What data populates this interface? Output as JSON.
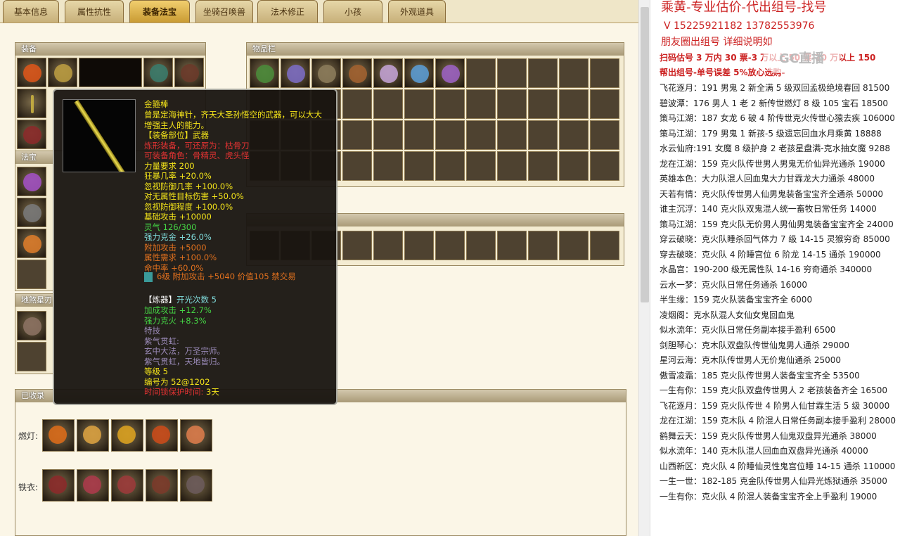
{
  "tabs": [
    "基本信息",
    "属性抗性",
    "装备法宝",
    "坐骑召唤兽",
    "法术修正",
    "小孩",
    "外观道具"
  ],
  "panels": {
    "equip": "装备",
    "fabao": "法宝",
    "didi": "地煞星刃",
    "items": "物品栏",
    "collected": "已收录"
  },
  "tooltip": {
    "name": "金箍棒",
    "lines": [
      {
        "t": "曾是定海神针，齐天大圣孙悟空的武器，可以大大",
        "c": "y"
      },
      {
        "t": "增强主人的能力。",
        "c": "y"
      },
      {
        "t": "【装备部位】武器",
        "c": "y"
      },
      {
        "t": "炼形装备，可还原为：枯骨刀",
        "c": "r"
      },
      {
        "t": "可装备角色：骨精灵、虎头怪",
        "c": "r"
      },
      {
        "t": "力量要求 200",
        "c": "y"
      },
      {
        "t": "狂暴几率 +20.0%",
        "c": "y"
      },
      {
        "t": "忽视防御几率 +100.0%",
        "c": "y"
      },
      {
        "t": "对无属性目标伤害 +50.0%",
        "c": "y"
      },
      {
        "t": "忽视防御程度 +100.0%",
        "c": "y"
      },
      {
        "t": "基础攻击 +10000",
        "c": "y"
      },
      {
        "t": "灵气 126/300",
        "c": "g"
      },
      {
        "t": "强力克金 +26.0%",
        "c": "c"
      },
      {
        "t": "附加攻击 +5000",
        "c": "o"
      },
      {
        "t": "属性需求 +100.0%",
        "c": "o"
      },
      {
        "t": "命中率 +60.0%",
        "c": "o"
      }
    ],
    "gem": "6级 附加攻击 +5040 价值105 禁交易",
    "lian_head": "【炼器】",
    "lian_count": "开光次数 5",
    "lian": [
      {
        "t": "加成攻击 +12.7%",
        "c": "g"
      },
      {
        "t": "强力克火 +8.3%",
        "c": "g"
      },
      {
        "t": "特技",
        "c": "p"
      },
      {
        "t": "紫气贯虹:",
        "c": "p"
      },
      {
        "t": "玄中大法，万圣宗师。",
        "c": "p"
      },
      {
        "t": "紫气贯虹，天地皆归。",
        "c": "p"
      },
      {
        "t": "等级 5",
        "c": "y"
      },
      {
        "t": "编号为 52@1202",
        "c": "y"
      }
    ],
    "time_label": "时间锁保护时间:",
    "time_val": "3天"
  },
  "collected": {
    "row1": "燃灯:",
    "row2": "铁衣:"
  },
  "chat": {
    "title": "乘黄-专业估价-代出组号-找号",
    "phone": "V 15225921182   13782553976",
    "line2": "朋友圈出组号   详细说明如",
    "line3": "扫码估号 3 万内 30 票-3 万以上 50 票-20 万以上 150",
    "line4": "帮出组号-单号误差 5%放心选购-",
    "watermark": "GC直播",
    "entries": [
      "飞花逐月：191 男鬼 2 新全满 5 级双回孟极绝境春回 81500",
      "碧波潭：176 男人 1 老 2 新传世燃灯 8 级 105 宝石 18500",
      "策马江湖：187 女龙 6 破 4 阶传世克火传世心猿去疾 106000",
      "策马江湖：179 男鬼 1 新孩-5 级遗忘回血水月乘黄 18888",
      "水云仙府:191 女魔 8 级护身 2 老孩星盘满-克水抽女魔 9288",
      "龙在江湖：159 克火队传世男人男鬼无价仙异光通杀 19000",
      "英雄本色：大力队混人回血鬼大力甘霖龙大力通杀 48000",
      "天若有情：克火队传世男人仙男鬼装备宝宝齐全通杀 50000",
      "谁主沉浮：140 克火队双鬼混人统一畜牧日常任务 14000",
      "策马江湖：159 克火队无价男人男仙男鬼装备宝宝齐全 24000",
      "穿云破晓：克火队睡杀回气体力 7 级 14-15 灵猴穷奇 85000",
      "穿去破晓：克火队 4 阶睡宫位 6 阶龙 14-15 通杀 190000",
      "水晶宫：190-200 级无属性队 14-16 穷奇通杀 340000",
      "云水一梦：克火队日常任务通杀 16000",
      "半生缘：159 克火队装备宝宝齐全 6000",
      "凌烟阁：克水队混人女仙女鬼回血鬼",
      "似水流年：克火队日常任务副本接手盈利 6500",
      "剑胆琴心：克木队双盘队传世仙鬼男人通杀 29000",
      "星河云海：克木队传世男人无价鬼仙通杀 25000",
      "傲雪凌霜：185 克火队传世男人装备宝宝齐全 53500",
      "一生有你：159 克火队双盘传世男人 2 老孩装备齐全 16500",
      "飞花逐月：159 克火队传世 4 阶男人仙甘霖生活 5 级 30000",
      "龙在江湖：159 克木队 4 阶混人日常任务副本接手盈利 28000",
      "鹤舞云天：159 克火队传世男人仙鬼双盘异光通杀 38000",
      "似水流年：140 克木队混人回血血双盘异光通杀 40000",
      "山西新区：克火队 4 阶睡仙灵性鬼宫位睡 14-15 通杀 110000",
      "一生一世：182-185 克金队传世男人仙异光炼狱通杀 35000",
      "一生有你：克火队 4 阶混人装备宝宝齐全上手盈利 19000"
    ]
  }
}
